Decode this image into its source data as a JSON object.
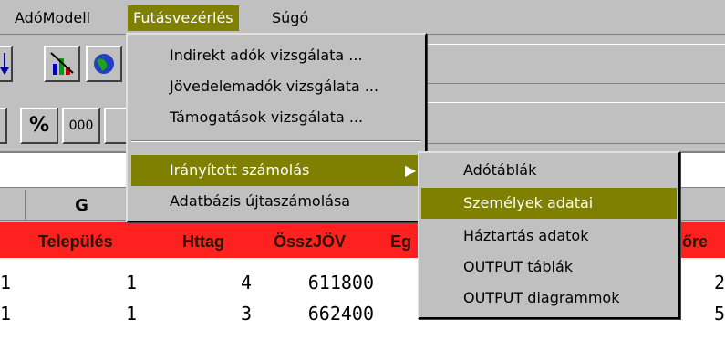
{
  "menubar": {
    "items": [
      {
        "label": "AdóModell"
      },
      {
        "label": "Futásvezérlés"
      },
      {
        "label": "Súgó"
      }
    ]
  },
  "toolbar": {
    "row1": [
      "down-arrow",
      "chart-wizard",
      "globe"
    ],
    "row2_percent": "%",
    "row2_thousands": "000"
  },
  "futas_menu": {
    "items": [
      {
        "label": "Indirekt adók vizsgálata ..."
      },
      {
        "label": "Jövedelemadók vizsgálata ..."
      },
      {
        "label": "Támogatások vizsgálata ..."
      },
      {
        "label": "Irányított számolás"
      },
      {
        "label": "Adatbázis újtaszámolása"
      }
    ]
  },
  "submenu": {
    "items": [
      {
        "label": "Adótáblák"
      },
      {
        "label": "Személyek adatai"
      },
      {
        "label": "Háztartás adatok"
      },
      {
        "label": "OUTPUT táblák"
      },
      {
        "label": "OUTPUT diagrammok"
      }
    ]
  },
  "sheet": {
    "column_G": "G",
    "headers": [
      "Település",
      "Httag",
      "ÖsszJÖV",
      "Eg",
      "őre"
    ],
    "rows": [
      {
        "a": "1",
        "b": "1",
        "c": "4",
        "d": "611800",
        "e": "2"
      },
      {
        "a": "1",
        "b": "1",
        "c": "3",
        "d": "662400",
        "e": "5"
      }
    ]
  },
  "colors": {
    "menu_highlight": "#808000",
    "header_row": "#ff2020",
    "face": "#c0c0c0"
  }
}
